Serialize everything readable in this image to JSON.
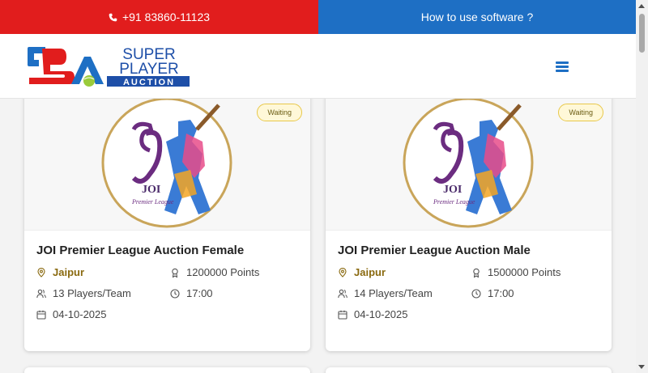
{
  "topbar": {
    "phone": "+91 83860-11123",
    "howto": "How to use software ?"
  },
  "logo": {
    "line1": "SUPER",
    "line2": "PLAYER",
    "line3": "AUCTION"
  },
  "colors": {
    "red": "#e11d1d",
    "blue": "#1e6fc4",
    "gold": "#8a6a10"
  },
  "cards": [
    {
      "status": "Waiting",
      "emblem_text": "JOI",
      "emblem_sub": "Premier League",
      "title": "JOI Premier League Auction Female",
      "city": "Jaipur",
      "points": "1200000 Points",
      "players": "13 Players/Team",
      "time": "17:00",
      "date": "04-10-2025"
    },
    {
      "status": "Waiting",
      "emblem_text": "JOI",
      "emblem_sub": "Premier League",
      "title": "JOI Premier League Auction Male",
      "city": "Jaipur",
      "points": "1500000 Points",
      "players": "14 Players/Team",
      "time": "17:00",
      "date": "04-10-2025"
    }
  ]
}
